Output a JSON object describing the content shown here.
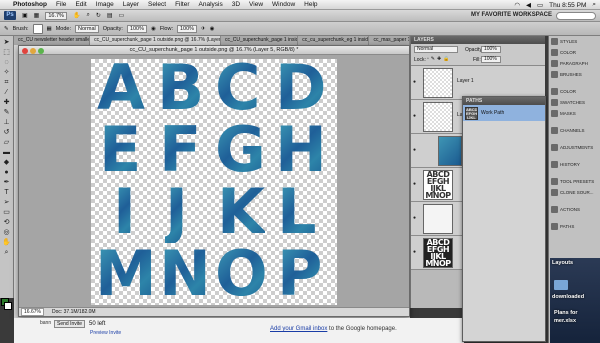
{
  "menubar": {
    "app": "Photoshop",
    "items": [
      "File",
      "Edit",
      "Image",
      "Layer",
      "Select",
      "Filter",
      "Analysis",
      "3D",
      "View",
      "Window",
      "Help"
    ],
    "clock": "Thu 8:55 PM"
  },
  "appbar": {
    "logo": "Ps",
    "zoom": "16.7%",
    "workspace": "MY FAVORITE WORKSPACE"
  },
  "options": {
    "brush_label": "Brush:",
    "mode_label": "Mode:",
    "mode_value": "Normal",
    "opacity_label": "Opacity:",
    "opacity_value": "100%",
    "flow_label": "Flow:",
    "flow_value": "100%"
  },
  "background_doc": {
    "tabs": [
      "cc_CU newsletter header smaller2.jpg",
      "cc_CU_superchunk_page 1 outside.png @ 16.7% (Layer 5, RGB/8) *",
      "cc_CU_superchunk_page 1 inside.png",
      "cc_cu_superchunk_eg 1 inside.png",
      "cc_mas_paper 14"
    ]
  },
  "document": {
    "title": "cc_CU_superchunk_page 1 outside.png @ 16.7% (Layer 5, RGB/8) *",
    "letters": [
      "A",
      "B",
      "C",
      "D",
      "E",
      "F",
      "G",
      "H",
      "I",
      "J",
      "K",
      "L",
      "M",
      "N",
      "O",
      "P"
    ],
    "status_zoom": "16.67%",
    "status_doc": "Doc: 37.1M/182.0M"
  },
  "browser": {
    "bann": "bann",
    "send_invite": "Send Invite",
    "left_count": "50 left",
    "preview": "Preview Invite",
    "gmail_link": "Add your Gmail inbox",
    "gmail_rest": " to the Google homepage."
  },
  "layers_panel": {
    "title": "LAYERS",
    "blend": "Normal",
    "opacity_label": "Opacity:",
    "opacity_value": "100%",
    "lock_label": "Lock:",
    "fill_label": "Fill:",
    "fill_value": "100%",
    "layers": [
      {
        "name": "Layer 1"
      },
      {
        "name": "La"
      },
      {
        "name": ""
      },
      {
        "name": ""
      },
      {
        "name": ""
      },
      {
        "name": ""
      }
    ]
  },
  "paths_panel": {
    "title": "PATHS",
    "item": "Work Path"
  },
  "dock": {
    "items": [
      "STYLES",
      "COLOR",
      "PARAGRAPH",
      "BRUSHES",
      "COLOR",
      "SWATCHES",
      "MASKS",
      "CHANNELS",
      "ADJUSTMENTS",
      "HISTORY",
      "TOOL PRESETS",
      "CLONE SOUR...",
      "ACTIONS",
      "PATHS"
    ]
  },
  "desktop": {
    "label1": "Layouts",
    "label2": "downloaded",
    "label3": "Plans for",
    "label4": "mer.xlsx"
  },
  "colors": {
    "foreground": "#2b7a2b",
    "background": "#ffffff",
    "letter_blue": "#1f5f98"
  }
}
